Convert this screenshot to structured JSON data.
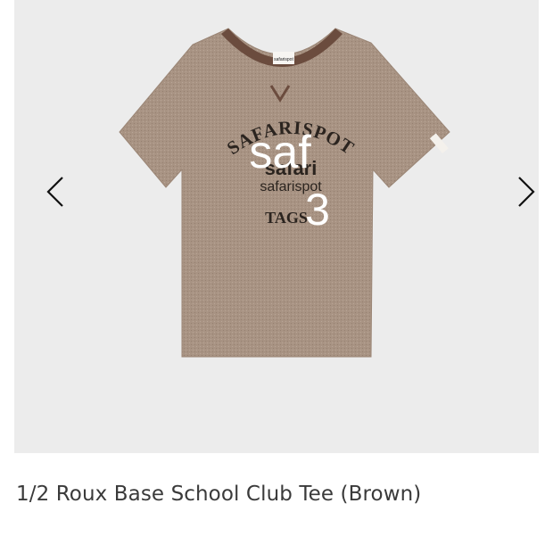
{
  "product": {
    "title": "1/2 Roux Base School Club Tee (Brown)"
  },
  "gallery": {
    "prev_icon": "chevron-left-icon",
    "next_icon": "chevron-right-icon"
  },
  "image": {
    "shirt_color": "#a89383",
    "trim_color": "#6b4c3e",
    "print": {
      "arc_text": "SAFARISPOT",
      "word_safari": "safari",
      "word_safarispot": "safarispot",
      "word_tags": "TAGS",
      "overlay_big": "saf",
      "overlay_num": "3",
      "neck_label": "safarispot",
      "sleeve_tag": "safarispot"
    }
  }
}
